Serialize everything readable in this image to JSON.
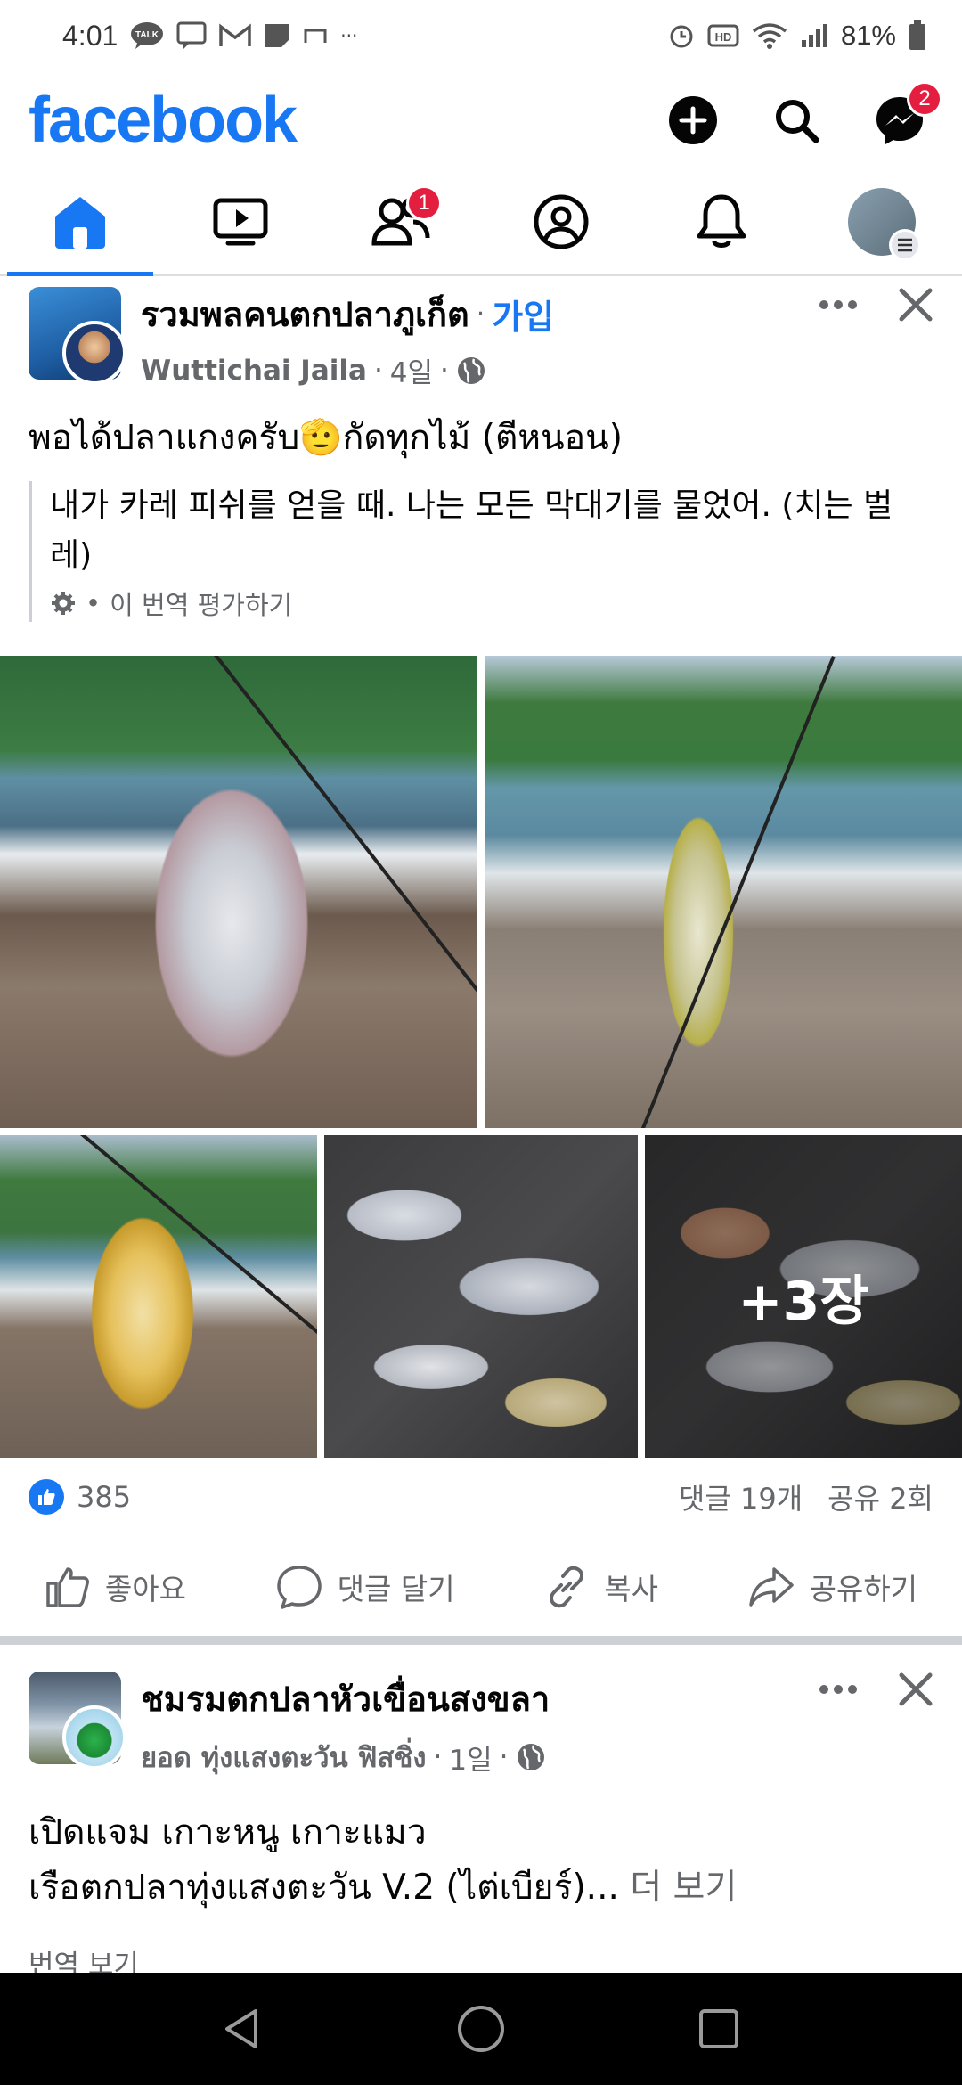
{
  "status_bar": {
    "time": "4:01",
    "battery": "81%",
    "talk": "TALK",
    "hd": "HD",
    "more": "···"
  },
  "header": {
    "logo": "facebook",
    "messenger_badge": "2"
  },
  "tabs": {
    "friends_badge": "1"
  },
  "post1": {
    "group_name": "รวมพลคนตกปลาภูเก็ต",
    "separator": "·",
    "join_label": "가입",
    "author": "Wuttichai Jaila",
    "age": "4일",
    "text_before_emoji": "พอได้ปลาแกงครับ",
    "emoji": "🫡",
    "text_after_emoji": "กัดทุกไม้ (ตีหนอน)",
    "translation": "내가 카레 피쉬를 얻을 때. 나는 모든 막대기를 물었어. (치는 벌레)",
    "rate_translation": "이 번역 평가하기",
    "photo_more": "+3장",
    "like_count": "385",
    "comments": "댓글 19개",
    "shares": "공유 2회",
    "actions": {
      "like": "좋아요",
      "comment": "댓글 달기",
      "copy": "복사",
      "share": "공유하기"
    }
  },
  "post2": {
    "group_name": "ชมรมตกปลาหัวเขื่อนสงขลา",
    "author": "ยอด ทุ่งแสงตะวัน ฟิสชิ่ง",
    "age": "1일",
    "line1": "เปิดแจม เกาะหนู เกาะแมว",
    "line2": "เรือตกปลาทุ่งแสงตะวัน V.2 (ไต่เบียร์)...",
    "see_more": "더 보기",
    "see_translation": "번역 보기"
  },
  "colors": {
    "brand": "#1877f2",
    "badge": "#e41e3f"
  }
}
